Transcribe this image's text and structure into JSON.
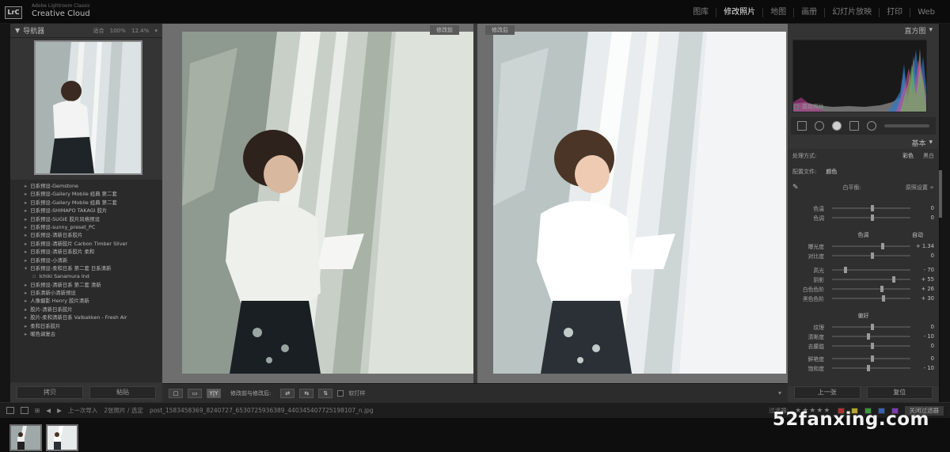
{
  "app": {
    "brand_small": "Adobe Lightroom Classic",
    "brand_big": "Creative Cloud",
    "logo": "LrC"
  },
  "modules": [
    "图库",
    "修改照片",
    "地图",
    "画册",
    "幻灯片放映",
    "打印",
    "Web"
  ],
  "active_module": "修改照片",
  "left_panel": {
    "navigator_title": "导航器",
    "zoom_options": "适合 100% 12.4% ▾",
    "presets": [
      "日系预设-Gemstone",
      "日系预设-Gallery Mobile 经典 第二套",
      "日系预设-Gallery Mobile 经典 第二套",
      "日系预设-SHIMAPO TAKAGI 胶片",
      "日系预设-SUGiE 胶片风格预设",
      "日系预设-sunny_preset_PC",
      "日系预设-清新日系胶片",
      "日系预设-清新胶片 Carbon Timber Silver",
      "日系预设-清新日系胶片 柔和",
      "日系预设-小清新",
      "日系预设-柔和日系 第二套 日系清新",
      "Ichiki Sanamura Ind",
      "日系预设-清新日系 第二套 清新",
      "日系清新小清新预设",
      "人像摄影 Henry 胶片清新",
      "胶片-清新日系胶片",
      "胶片-柔和清新日系 Valbakken - Fresh Air",
      "柔和日系胶片",
      "暖色调复古"
    ],
    "btn_copy": "拷贝",
    "btn_paste": "粘贴"
  },
  "center": {
    "tag_before": "修改前",
    "tag_after": "修改后",
    "toolbar": {
      "view_btn_1": "□",
      "view_btn_2": "▭",
      "view_btn_3": "Y|Y",
      "label": "修改前与修改后:",
      "swap_btn_1": "⇄",
      "swap_btn_2": "⇆",
      "swap_btn_3": "⇅",
      "softproof": "软打样"
    }
  },
  "right_panel": {
    "histogram_title": "直方图",
    "original_photo": "原始照片",
    "basic_title": "基本",
    "treatment_label": "处理方式:",
    "treatment_color": "彩色",
    "treatment_bw": "黑白",
    "profile_label": "配置文件:",
    "profile_value": "颜色",
    "wb_label": "白平衡:",
    "wb_value": "原照设置 ÷",
    "sliders_wb": [
      {
        "label": "色温",
        "value": "0"
      },
      {
        "label": "色调",
        "value": "0"
      }
    ],
    "tone_title": "色调",
    "tone_auto": "自动",
    "sliders_tone": [
      {
        "label": "曝光度",
        "value": "+ 1.34"
      },
      {
        "label": "对比度",
        "value": "0"
      },
      {
        "label": "高光",
        "value": "- 70"
      },
      {
        "label": "阴影",
        "value": "+ 55"
      },
      {
        "label": "白色色阶",
        "value": "+ 26"
      },
      {
        "label": "黑色色阶",
        "value": "+ 30"
      }
    ],
    "presence_title": "偏好",
    "sliders_presence": [
      {
        "label": "纹理",
        "value": "0"
      },
      {
        "label": "清晰度",
        "value": "- 10"
      },
      {
        "label": "去朦胧",
        "value": "0"
      },
      {
        "label": "鲜艳度",
        "value": "0"
      },
      {
        "label": "饱和度",
        "value": "- 10"
      }
    ],
    "btn_prev": "上一张",
    "btn_reset": "复位"
  },
  "filmstrip": {
    "prev_import": "上一次导入",
    "count": "2张照片 / 选定",
    "filename": "post_1583458369_8240727_6530725936389_440345407725198107_n.jpg",
    "filter_label": "过滤器:",
    "filter_value": "关闭过滤器"
  },
  "watermark": "52fanxing.com"
}
